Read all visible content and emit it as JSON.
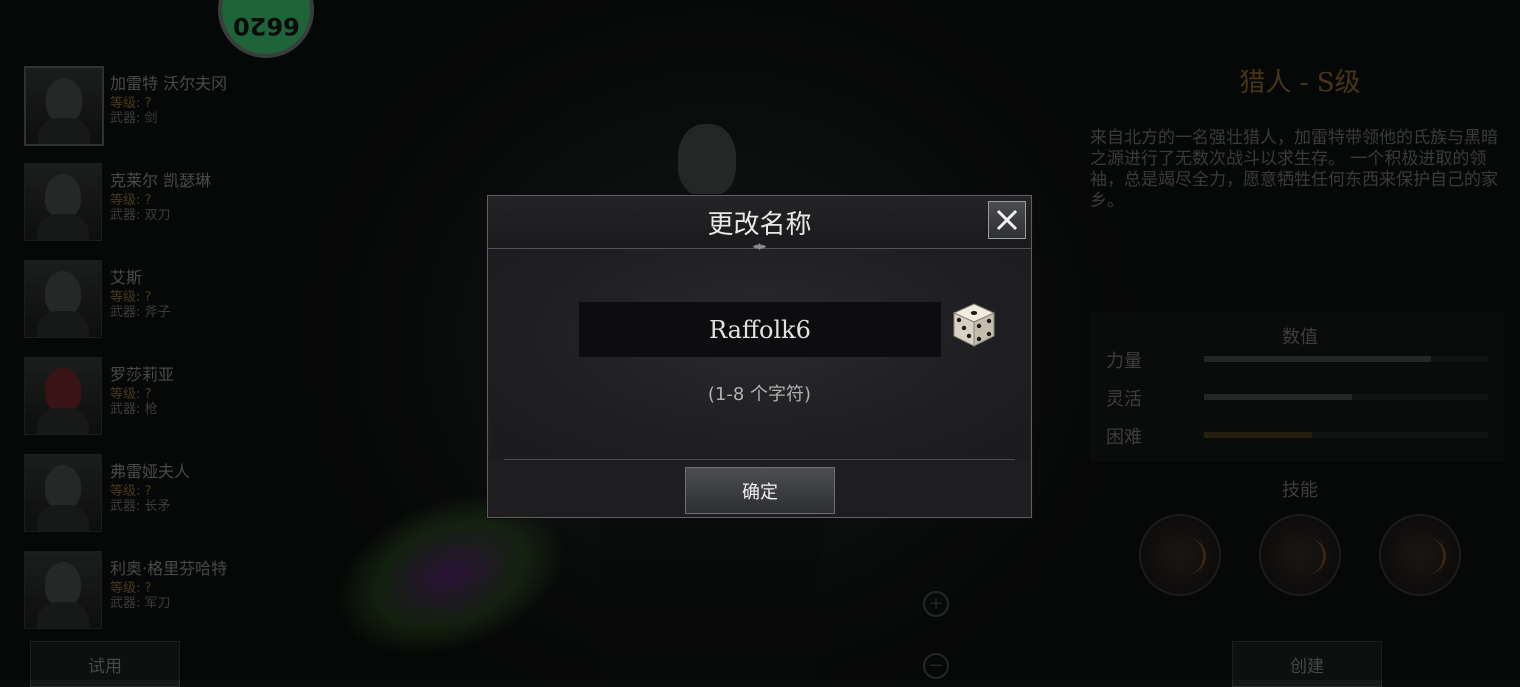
{
  "coin": {
    "label": "6620"
  },
  "roster": [
    {
      "name": "加雷特 沃尔夫冈",
      "level": "等级: ?",
      "weapon": "武器: 剑"
    },
    {
      "name": "克莱尔 凯瑟琳",
      "level": "等级: ?",
      "weapon": "武器: 双刀"
    },
    {
      "name": "艾斯",
      "level": "等级: ?",
      "weapon": "武器: 斧子"
    },
    {
      "name": "罗莎莉亚",
      "level": "等级: ?",
      "weapon": "武器: 枪"
    },
    {
      "name": "弗雷娅夫人",
      "level": "等级: ?",
      "weapon": "武器: 长矛"
    },
    {
      "name": "利奥·格里芬哈特",
      "level": "等级: ?",
      "weapon": "武器: 军刀"
    }
  ],
  "trial_label": "试用",
  "class_panel": {
    "title": "猎人 - S级",
    "description": "来自北方的一名强壮猎人，加雷特带领他的氏族与黑暗之源进行了无数次战斗以求生存。 一个积极进取的领袖，总是竭尽全力，愿意牺牲任何东西来保护自己的家乡。",
    "stats_title": "数值",
    "stats": [
      {
        "label": "力量",
        "value": 0.8
      },
      {
        "label": "灵活",
        "value": 0.52
      },
      {
        "label": "困难",
        "value": 0.38
      }
    ],
    "skills_title": "技能",
    "create_label": "创建"
  },
  "dialog": {
    "title": "更改名称",
    "name_value": "Raffolk6",
    "hint": "(1-8 个字符)",
    "confirm_label": "确定"
  },
  "icons": [
    "close-icon",
    "dice-icon",
    "zoom-in-icon",
    "zoom-out-icon"
  ]
}
